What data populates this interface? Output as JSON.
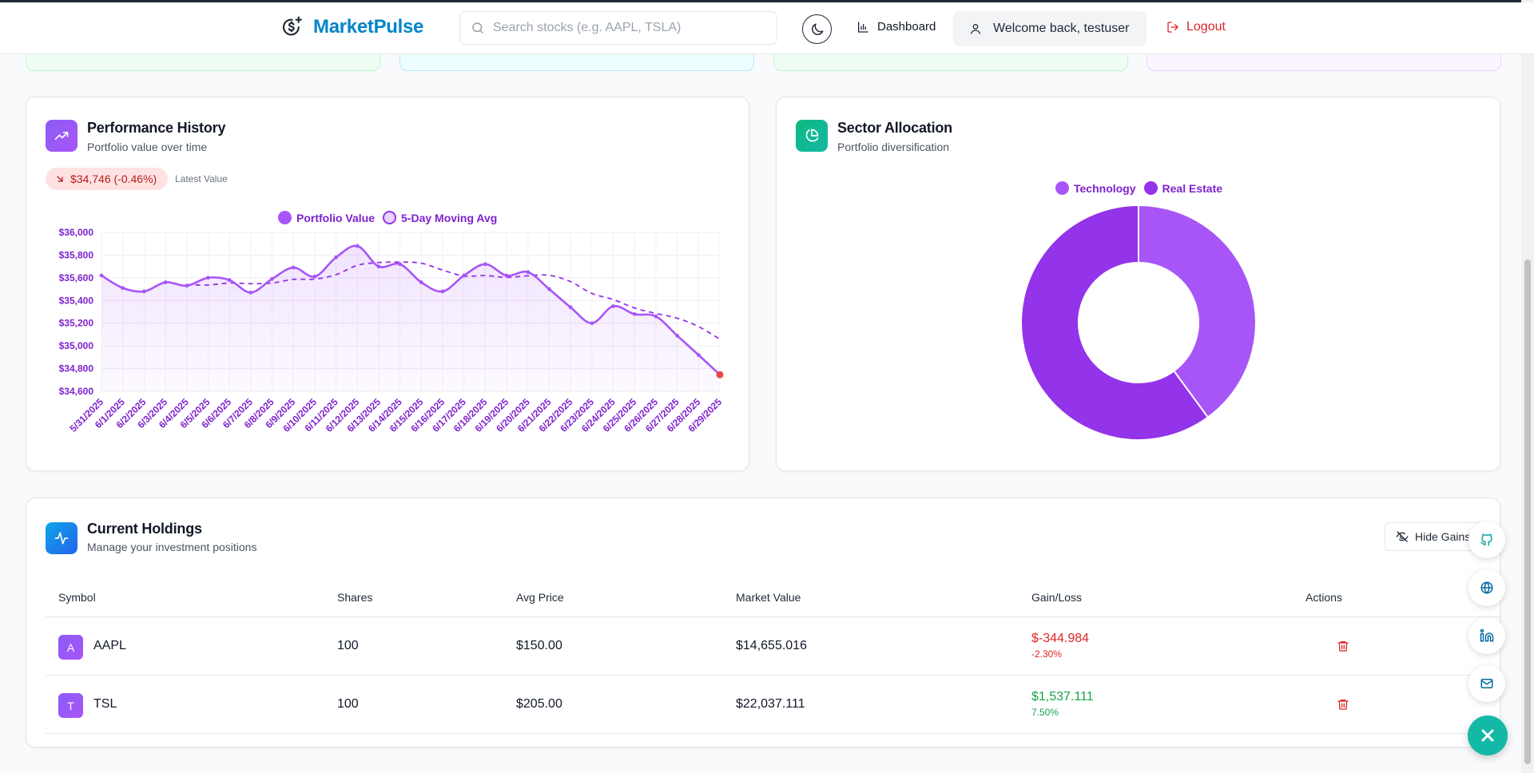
{
  "header": {
    "brand": "MarketPulse",
    "search_placeholder": "Search stocks (e.g. AAPL, TSLA)",
    "nav_dashboard": "Dashboard",
    "welcome": "Welcome back, testuser",
    "logout": "Logout",
    "icons": [
      "dollar-sparkle-icon",
      "search-icon",
      "moon-icon",
      "bar-chart-icon",
      "user-icon",
      "logout-icon"
    ]
  },
  "performance": {
    "title": "Performance History",
    "subtitle": "Portfolio value over time",
    "badge": "$34,746 (-0.46%)",
    "badge_note": "Latest Value",
    "legend": [
      "Portfolio Value",
      "5-Day Moving Avg"
    ]
  },
  "sector": {
    "title": "Sector Allocation",
    "subtitle": "Portfolio diversification",
    "legend": [
      "Technology",
      "Real Estate"
    ]
  },
  "holdings": {
    "title": "Current Holdings",
    "subtitle": "Manage your investment positions",
    "hide_gains": "Hide Gains",
    "columns": [
      "Symbol",
      "Shares",
      "Avg Price",
      "Market Value",
      "Gain/Loss",
      "Actions"
    ],
    "rows": [
      {
        "initial": "A",
        "symbol": "AAPL",
        "shares": "100",
        "avg_price": "$150.00",
        "market_value": "$14,655.016",
        "gain": "$-344.984",
        "gain_pct": "-2.30%",
        "positive": false
      },
      {
        "initial": "T",
        "symbol": "TSL",
        "shares": "100",
        "avg_price": "$205.00",
        "market_value": "$22,037.111",
        "gain": "$1,537.111",
        "gain_pct": "7.50%",
        "positive": true
      }
    ]
  },
  "colors": {
    "brand": "#0284c7",
    "purple": "#9333ea",
    "purple_light": "#a855f7",
    "loss": "#dc2626",
    "gain": "#16a34a",
    "teal": "#14b8a6"
  },
  "chart_data": [
    {
      "type": "line",
      "x": [
        "5/31/2025",
        "6/1/2025",
        "6/2/2025",
        "6/3/2025",
        "6/4/2025",
        "6/5/2025",
        "6/6/2025",
        "6/7/2025",
        "6/8/2025",
        "6/9/2025",
        "6/10/2025",
        "6/11/2025",
        "6/12/2025",
        "6/13/2025",
        "6/14/2025",
        "6/15/2025",
        "6/16/2025",
        "6/17/2025",
        "6/18/2025",
        "6/19/2025",
        "6/20/2025",
        "6/21/2025",
        "6/22/2025",
        "6/23/2025",
        "6/24/2025",
        "6/25/2025",
        "6/26/2025",
        "6/27/2025",
        "6/28/2025",
        "6/29/2025"
      ],
      "series": [
        {
          "name": "Portfolio Value",
          "values": [
            35620,
            35510,
            35480,
            35560,
            35530,
            35600,
            35580,
            35470,
            35590,
            35690,
            35610,
            35780,
            35880,
            35700,
            35720,
            35560,
            35480,
            35620,
            35720,
            35620,
            35650,
            35500,
            35340,
            35200,
            35350,
            35280,
            35260,
            35090,
            34920,
            34746
          ]
        },
        {
          "name": "5-Day Moving Avg",
          "values": [
            null,
            null,
            null,
            null,
            35540,
            35536,
            35554,
            35548,
            35554,
            35586,
            35588,
            35628,
            35710,
            35734,
            35738,
            35728,
            35668,
            35616,
            35620,
            35604,
            35618,
            35622,
            35566,
            35462,
            35408,
            35334,
            35286,
            35244,
            35170,
            35059
          ]
        }
      ],
      "ylim": [
        34600,
        36000
      ],
      "yticks": [
        "$34,600",
        "$34,800",
        "$35,000",
        "$35,200",
        "$35,400",
        "$35,600",
        "$35,800",
        "$36,000"
      ]
    },
    {
      "type": "pie",
      "categories": [
        "Technology",
        "Real Estate"
      ],
      "values": [
        39.94,
        60.06
      ],
      "colors": [
        "#a855f7",
        "#9333ea"
      ]
    }
  ]
}
